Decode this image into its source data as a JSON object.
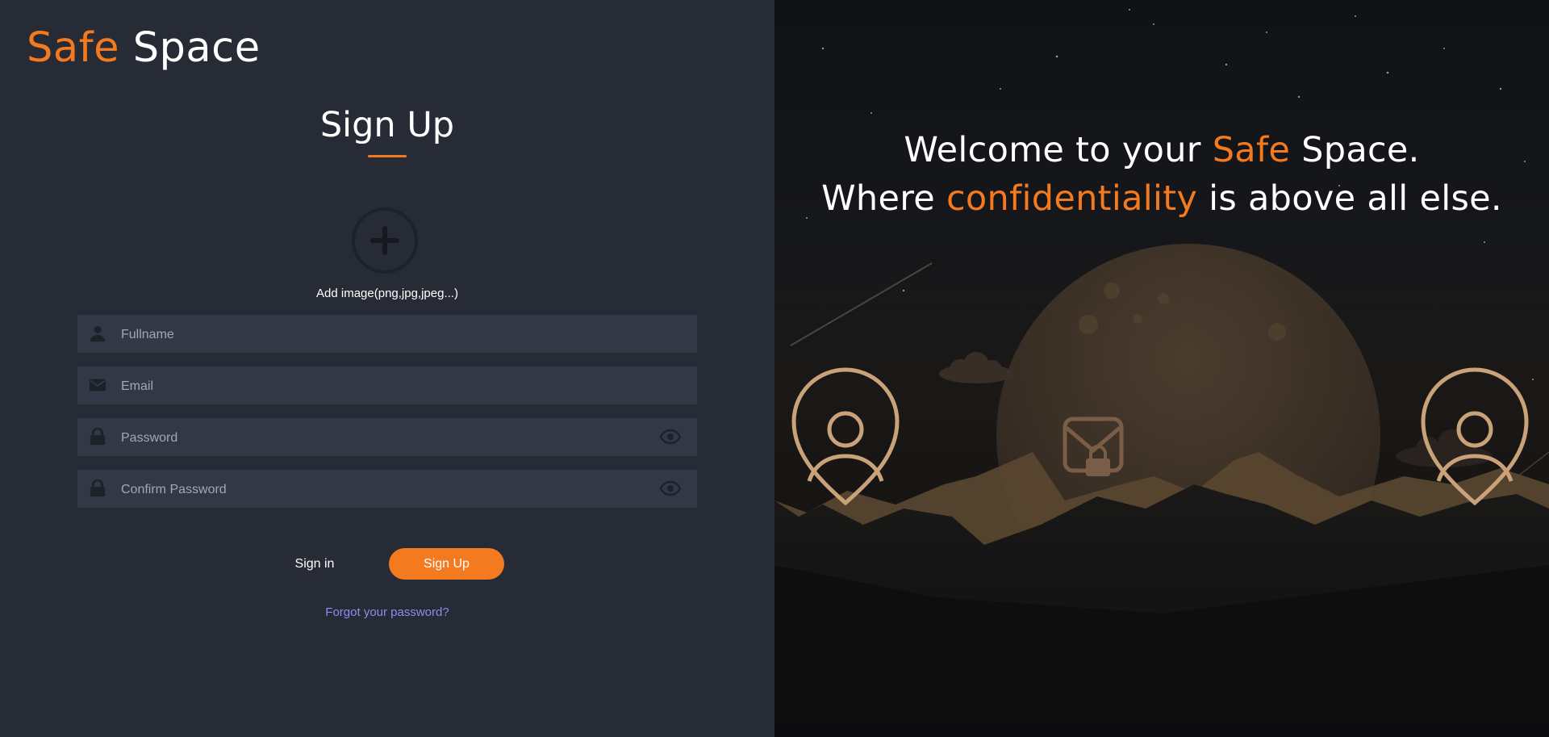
{
  "brand": {
    "part1": "Safe",
    "part2": "Space"
  },
  "form": {
    "title": "Sign Up",
    "avatar_label": "Add image(png,jpg,jpeg...)",
    "fields": {
      "fullname": {
        "placeholder": "Fullname",
        "value": ""
      },
      "email": {
        "placeholder": "Email",
        "value": ""
      },
      "password": {
        "placeholder": "Password",
        "value": ""
      },
      "confirm": {
        "placeholder": "Confirm Password",
        "value": ""
      }
    },
    "signin_label": "Sign in",
    "signup_label": "Sign Up",
    "forgot_label": "Forgot your password?"
  },
  "hero": {
    "line1_pre": "Welcome to your ",
    "line1_accent": "Safe",
    "line1_post": " Space.",
    "line2_pre": "Where ",
    "line2_accent": "confidentiality",
    "line2_post": " is above all else."
  },
  "colors": {
    "accent": "#f47a1f",
    "panel_bg": "#262b35",
    "input_bg": "#323845",
    "link": "#8f8bf0",
    "icon_gold": "#c9a27a"
  },
  "icons": [
    "plus-icon",
    "user-icon",
    "mail-icon",
    "lock-icon",
    "eye-icon",
    "user-pin-icon",
    "mail-lock-icon"
  ]
}
